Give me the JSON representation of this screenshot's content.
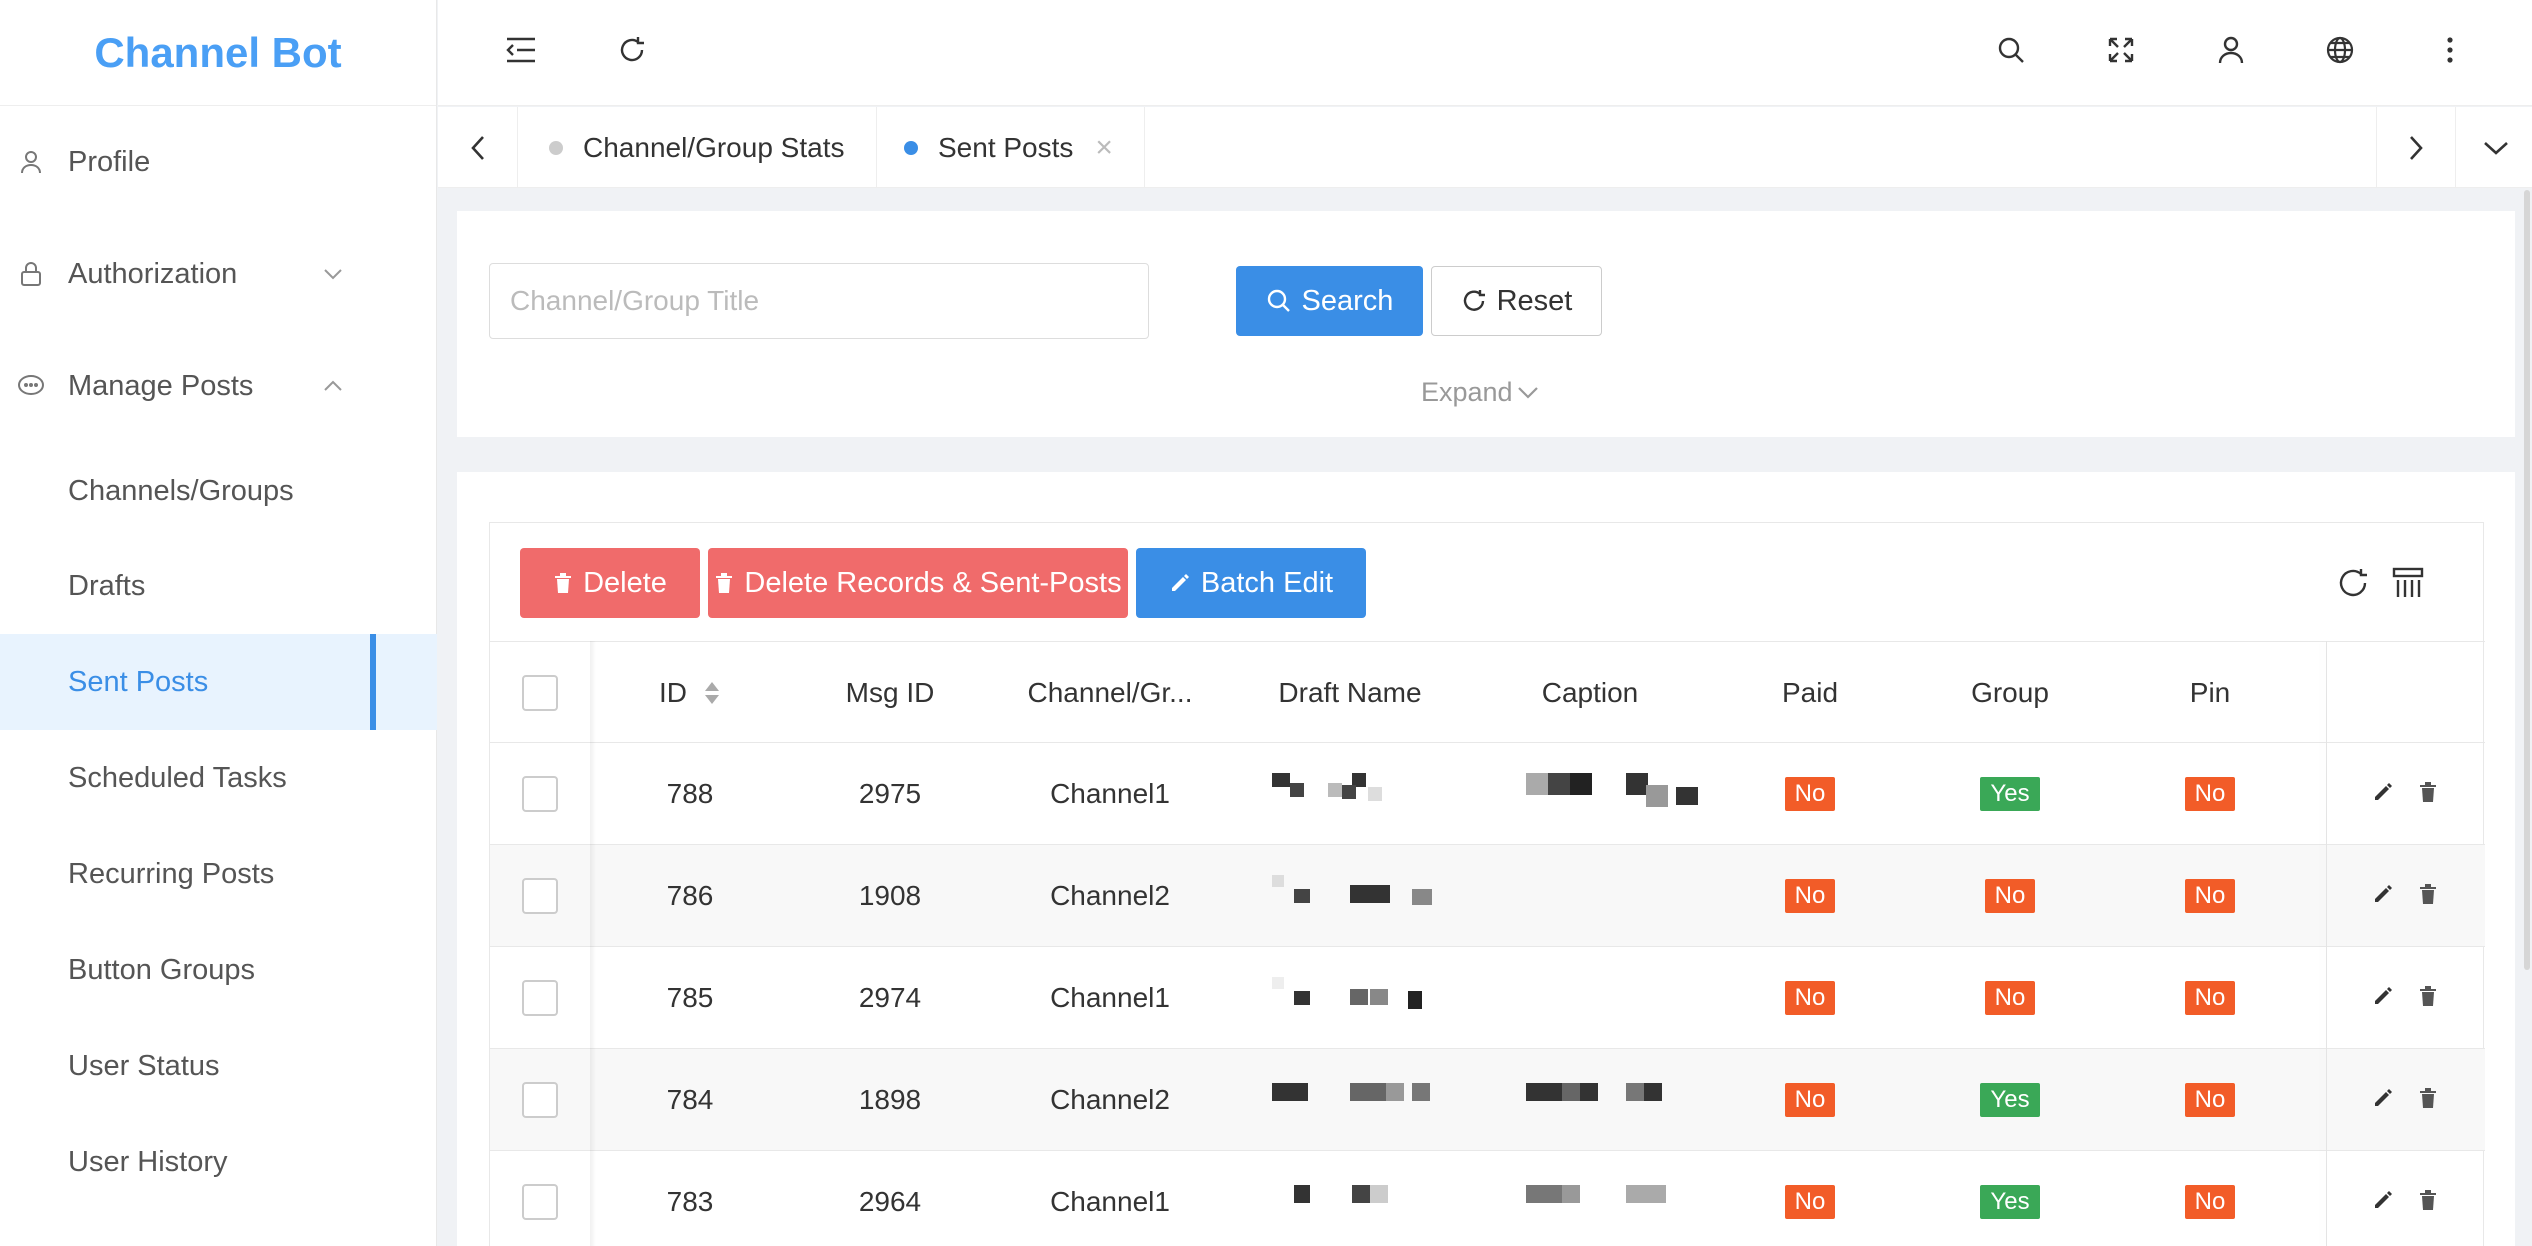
{
  "app": {
    "title": "Channel Bot"
  },
  "sidebar": {
    "items": [
      {
        "label": "Profile",
        "icon": "user-icon"
      },
      {
        "label": "Authorization",
        "icon": "lock-icon",
        "expandable": true,
        "expanded": false
      },
      {
        "label": "Manage Posts",
        "icon": "chat-icon",
        "expandable": true,
        "expanded": true
      },
      {
        "label": "Channels/Groups"
      },
      {
        "label": "Drafts"
      },
      {
        "label": "Sent Posts",
        "active": true
      },
      {
        "label": "Scheduled Tasks"
      },
      {
        "label": "Recurring Posts"
      },
      {
        "label": "Button Groups"
      },
      {
        "label": "User Status"
      },
      {
        "label": "User History"
      }
    ]
  },
  "topbar": {
    "icons": [
      "menu-fold-icon",
      "refresh-icon",
      "search-icon",
      "fullscreen-icon",
      "user-icon",
      "globe-icon",
      "more-vertical-icon"
    ]
  },
  "tabs": [
    {
      "label": "Channel/Group Stats",
      "active": false
    },
    {
      "label": "Sent Posts",
      "active": true,
      "closable": true
    }
  ],
  "search": {
    "placeholder": "Channel/Group Title",
    "value": "",
    "search_label": "Search",
    "reset_label": "Reset",
    "expand_label": "Expand"
  },
  "toolbar": {
    "delete_label": "Delete",
    "delete_records_label": "Delete Records & Sent-Posts",
    "batch_edit_label": "Batch Edit"
  },
  "table": {
    "columns": [
      "ID",
      "Msg ID",
      "Channel/Gr...",
      "Draft Name",
      "Caption",
      "Paid",
      "Group",
      "Pin"
    ],
    "rows": [
      {
        "id": "788",
        "msg_id": "2975",
        "channel": "Channel1",
        "paid": "No",
        "group": "Yes",
        "pin": "No"
      },
      {
        "id": "786",
        "msg_id": "1908",
        "channel": "Channel2",
        "paid": "No",
        "group": "No",
        "pin": "No"
      },
      {
        "id": "785",
        "msg_id": "2974",
        "channel": "Channel1",
        "paid": "No",
        "group": "No",
        "pin": "No"
      },
      {
        "id": "784",
        "msg_id": "1898",
        "channel": "Channel2",
        "paid": "No",
        "group": "Yes",
        "pin": "No"
      },
      {
        "id": "783",
        "msg_id": "2964",
        "channel": "Channel1",
        "paid": "No",
        "group": "Yes",
        "pin": "No"
      }
    ]
  },
  "colors": {
    "accent": "#3a8ee6",
    "danger": "#f06b6b",
    "tag_no": "#f25c28",
    "tag_yes": "#3aa857"
  }
}
